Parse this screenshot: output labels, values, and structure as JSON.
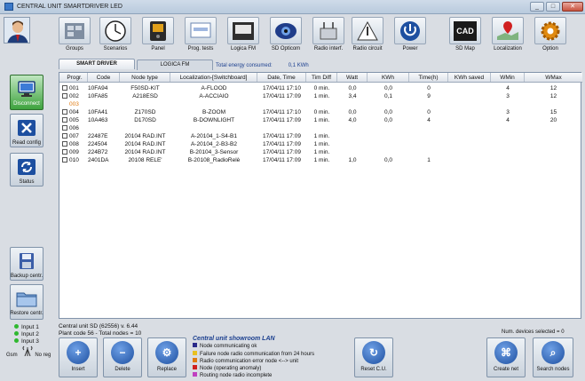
{
  "window": {
    "title": "CENTRAL UNIT SMARTDRIVER LED",
    "min": "_",
    "max": "□",
    "close": "✕"
  },
  "toolbar": [
    {
      "label": "Groups",
      "icon": "groups-icon"
    },
    {
      "label": "Scenarios",
      "icon": "clock-icon"
    },
    {
      "label": "Panel",
      "icon": "panel-icon"
    },
    {
      "label": "Prog. tests",
      "icon": "prog-tests-icon"
    },
    {
      "label": "Logica FM",
      "icon": "logica-fm-icon"
    },
    {
      "label": "SD Opticom",
      "icon": "opticom-icon"
    },
    {
      "label": "Radio interf.",
      "icon": "radio-interface-icon"
    },
    {
      "label": "Radio circuit",
      "icon": "radio-circuit-icon"
    },
    {
      "label": "Power",
      "icon": "power-icon"
    },
    {
      "label": "SD Map",
      "icon": "cad-icon",
      "badge": "CAD"
    },
    {
      "label": "Localization",
      "icon": "map-pin-icon"
    },
    {
      "label": "Option",
      "icon": "gear-icon"
    }
  ],
  "tabs": [
    {
      "label": "SMART DRIVER",
      "active": true
    },
    {
      "label": "LOGICA FM",
      "active": false
    }
  ],
  "energy": {
    "label": "Total energy consumed:",
    "value": "0,1 KWh"
  },
  "table": {
    "headers": [
      "Progr.",
      "Code",
      "Node type",
      "Localization-[Switchboard]",
      "Date, Time",
      "Tim Diff",
      "Watt",
      "KWh",
      "Time(h)",
      "KWh saved",
      "WMin",
      "WMax"
    ],
    "rows": [
      {
        "progr": "001",
        "code": "10FA94",
        "type": "F50SD-KIT",
        "loc": "A-FLOOD",
        "date": "17/04/11 17:10",
        "diff": "0 min.",
        "watt": "0,0",
        "kwh": "0,0",
        "time": "0",
        "saved": "",
        "wmin": "4",
        "wmax": "12",
        "style": "normal",
        "check": true
      },
      {
        "progr": "002",
        "code": "10FA85",
        "type": "A218ESD",
        "loc": "A-ACCIAIO",
        "date": "17/04/11 17:09",
        "diff": "1 min.",
        "watt": "3,4",
        "kwh": "0,1",
        "time": "9",
        "saved": "",
        "wmin": "3",
        "wmax": "12",
        "style": "normal",
        "check": true
      },
      {
        "progr": "003",
        "code": "",
        "type": "",
        "loc": "",
        "date": "",
        "diff": "",
        "watt": "",
        "kwh": "",
        "time": "",
        "saved": "",
        "wmin": "",
        "wmax": "",
        "style": "orange",
        "check": false
      },
      {
        "progr": "004",
        "code": "10FA41",
        "type": "Z170SD",
        "loc": "B-ZOOM",
        "date": "17/04/11 17:10",
        "diff": "0 min.",
        "watt": "0,0",
        "kwh": "0,0",
        "time": "0",
        "saved": "",
        "wmin": "3",
        "wmax": "15",
        "style": "normal",
        "check": true
      },
      {
        "progr": "005",
        "code": "10A463",
        "type": "D170SD",
        "loc": "B-DOWNLIGHT",
        "date": "17/04/11 17:09",
        "diff": "1 min.",
        "watt": "4,0",
        "kwh": "0,0",
        "time": "4",
        "saved": "",
        "wmin": "4",
        "wmax": "20",
        "style": "normal",
        "check": true
      },
      {
        "progr": "006",
        "code": "",
        "type": "",
        "loc": "",
        "date": "",
        "diff": "",
        "watt": "",
        "kwh": "",
        "time": "",
        "saved": "",
        "wmin": "",
        "wmax": "",
        "style": "normal",
        "check": true
      },
      {
        "progr": "007",
        "code": "22487E",
        "type": "20104 RAD.INT",
        "loc": "A-20104_1-S4-B1",
        "date": "17/04/11 17:09",
        "diff": "1 min.",
        "watt": "",
        "kwh": "",
        "time": "",
        "saved": "",
        "wmin": "",
        "wmax": "",
        "style": "normal",
        "check": true
      },
      {
        "progr": "008",
        "code": "224504",
        "type": "20104 RAD.INT",
        "loc": "A-20104_2-B3-B2",
        "date": "17/04/11 17:09",
        "diff": "1 min.",
        "watt": "",
        "kwh": "",
        "time": "",
        "saved": "",
        "wmin": "",
        "wmax": "",
        "style": "normal",
        "check": true
      },
      {
        "progr": "009",
        "code": "224B72",
        "type": "20104 RAD.INT",
        "loc": "B-20104_3-Sensor",
        "date": "17/04/11 17:09",
        "diff": "1 min.",
        "watt": "",
        "kwh": "",
        "time": "",
        "saved": "",
        "wmin": "",
        "wmax": "",
        "style": "normal",
        "check": true
      },
      {
        "progr": "010",
        "code": "2401DA",
        "type": "20108 RELE'",
        "loc": "B-20108_RadioRelè",
        "date": "17/04/11 17:09",
        "diff": "1 min.",
        "watt": "1,0",
        "kwh": "0,0",
        "time": "1",
        "saved": "",
        "wmin": "",
        "wmax": "",
        "style": "normal",
        "check": true
      }
    ]
  },
  "left": {
    "disconnect": "Disconnect",
    "read_config": "Read config",
    "status": "Status",
    "backup": "Backup centr.",
    "restore": "Restore centr."
  },
  "inputs": [
    "Input 1",
    "Input 2",
    "Input 3"
  ],
  "gsm": {
    "label": "Gsm",
    "status": "No reg"
  },
  "info": {
    "unit": "Central unit SD (62556)  v. 6.44",
    "plant": "Plant code 56 - Total nodes = 10"
  },
  "bottom": {
    "insert": "Insert",
    "delete": "Delete",
    "replace": "Replace",
    "reset": "Reset C.U.",
    "create": "Create net",
    "search": "Search nodes"
  },
  "legend": {
    "title": "Central unit showroom  LAN",
    "items": [
      {
        "text": "Node communicating ok",
        "color": "#2a2a8a"
      },
      {
        "text": "Failure node radio communication from 24 hours",
        "color": "#e8c020"
      },
      {
        "text": "Radio communication error node <--> unit",
        "color": "#e07a10"
      },
      {
        "text": "Node (operating anomaly)",
        "color": "#d02020"
      },
      {
        "text": "Routing node radio incomplete",
        "color": "#c040c0"
      }
    ]
  },
  "num_selected": "Num. devices selected = 0"
}
